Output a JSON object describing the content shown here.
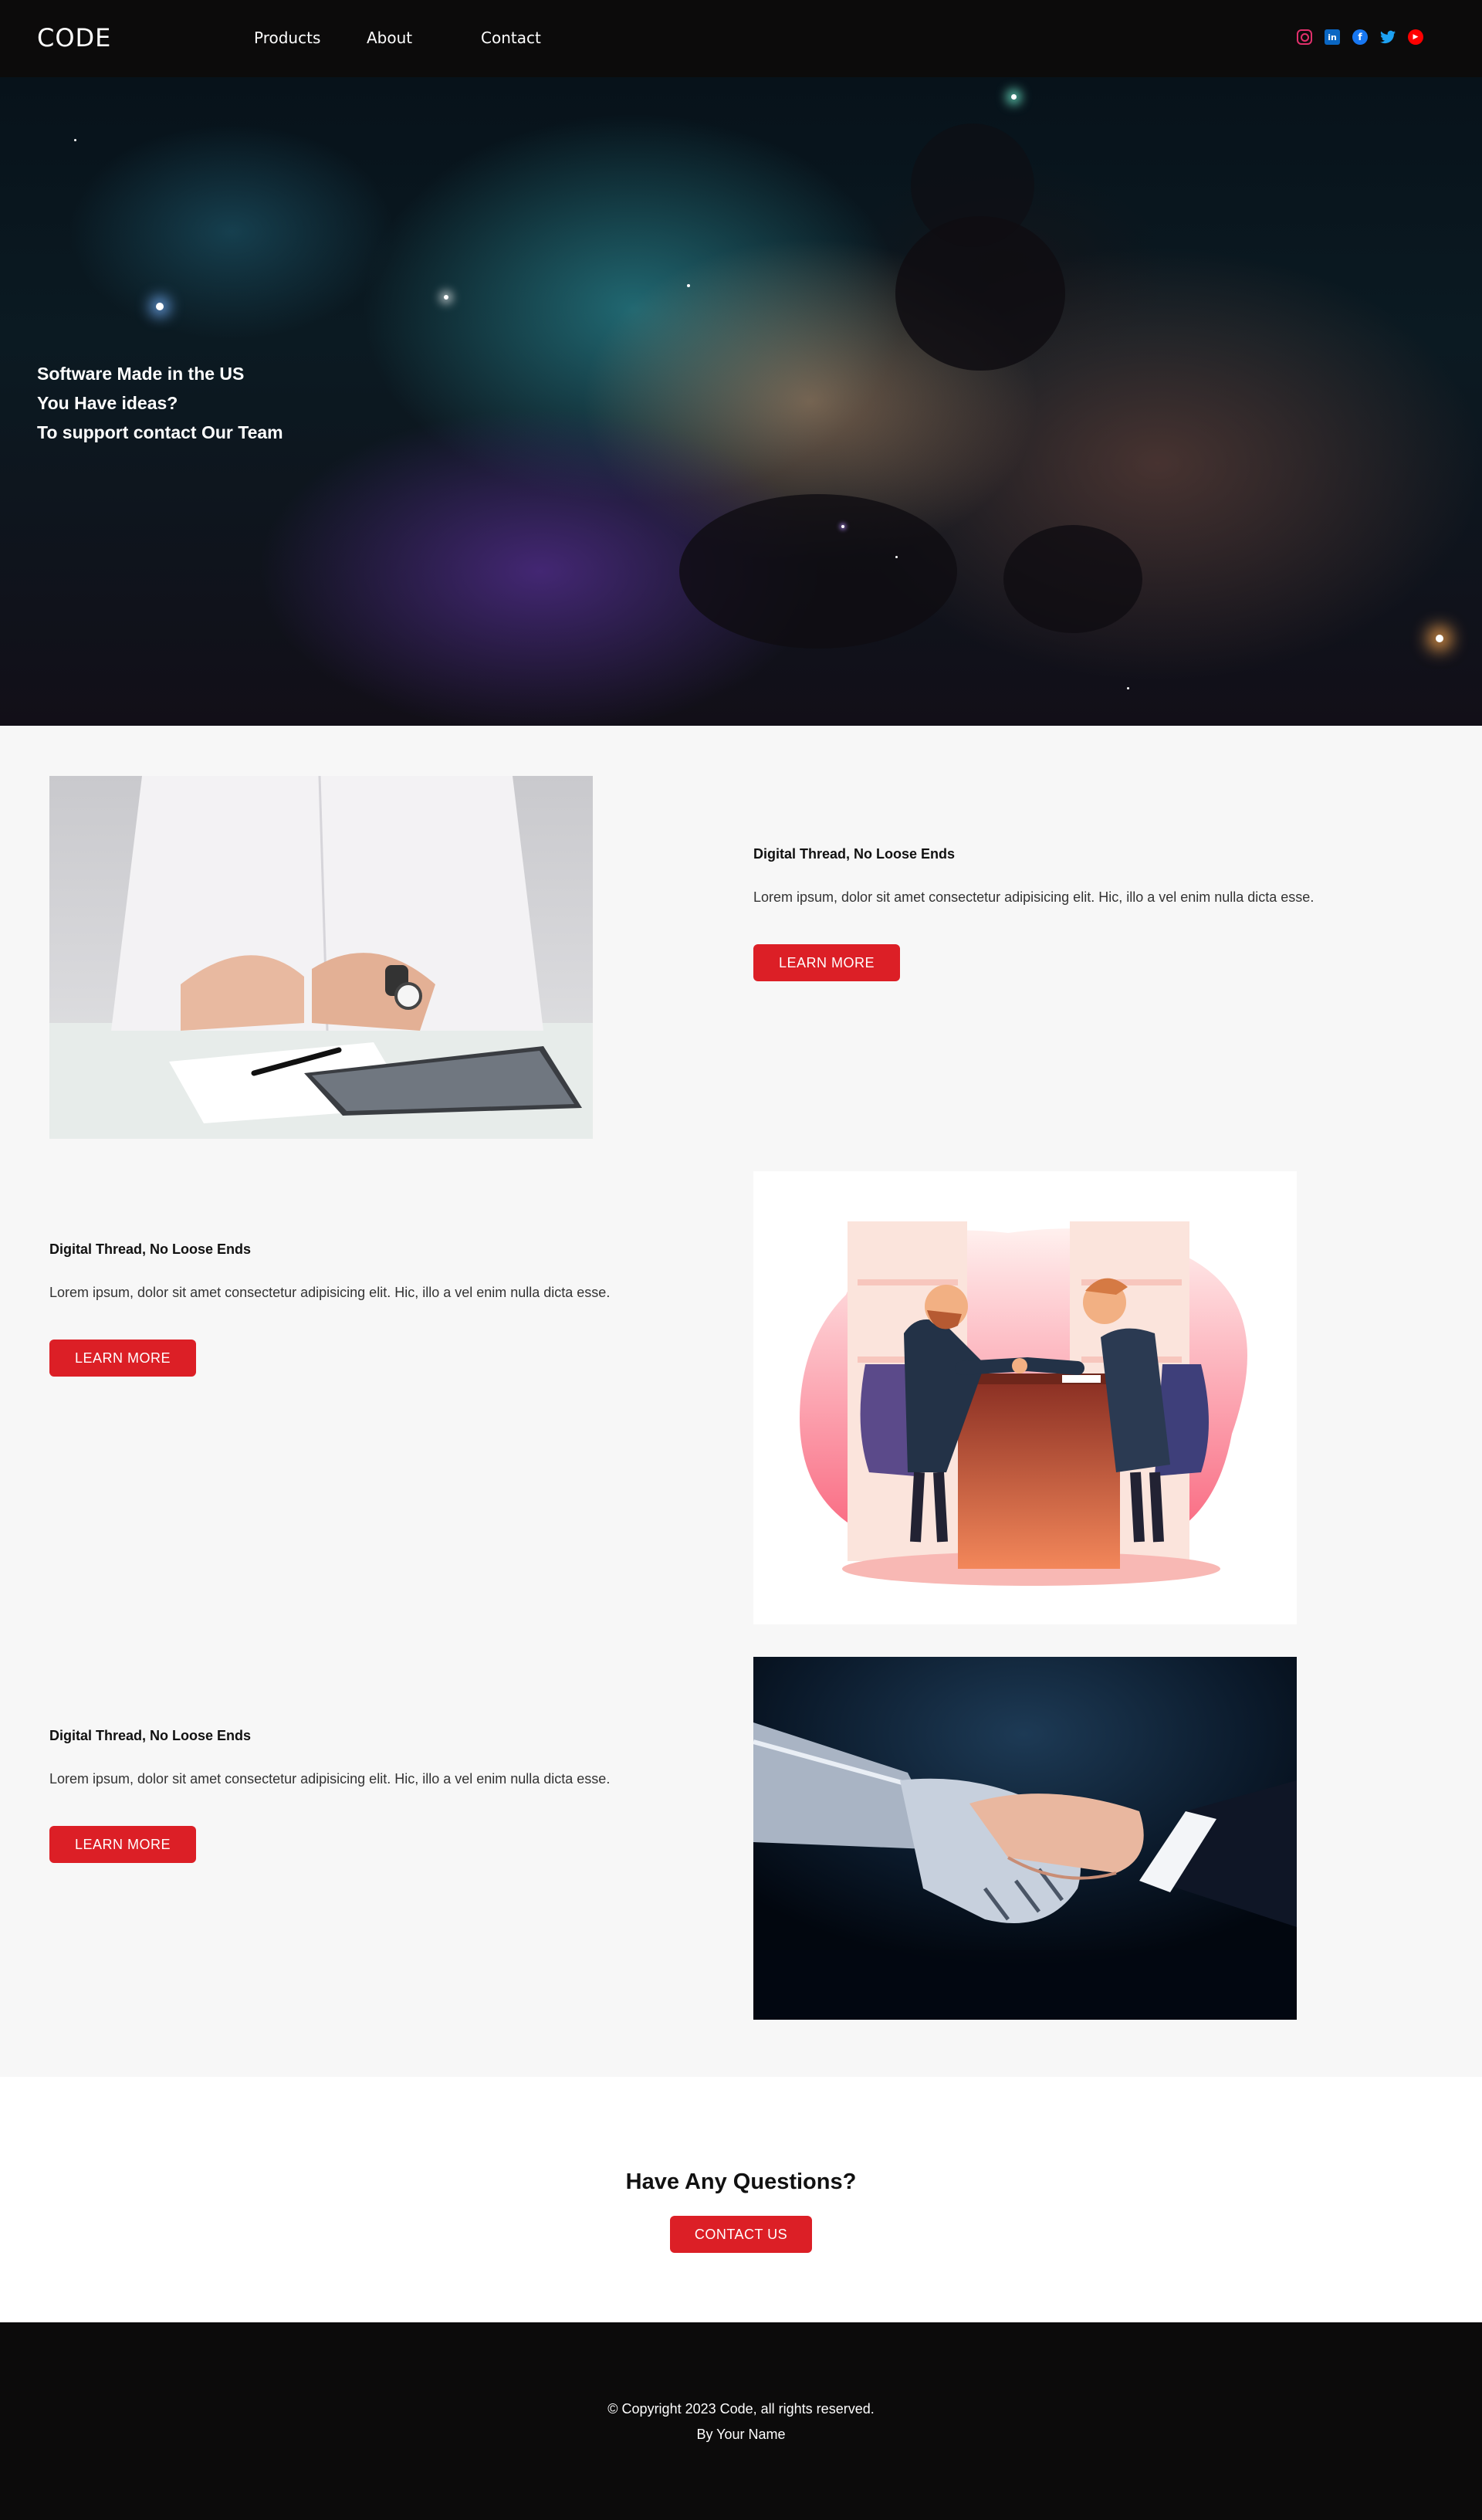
{
  "nav": {
    "logo": "CODE",
    "links": [
      "Products",
      "About",
      "Contact"
    ],
    "socials": [
      "instagram-icon",
      "linkedin-icon",
      "facebook-icon",
      "twitter-icon",
      "youtube-icon"
    ]
  },
  "hero": {
    "lines": [
      "Software Made in the US",
      "You Have ideas?",
      "To support contact Our Team"
    ]
  },
  "features": [
    {
      "title": "Digital Thread, No Loose Ends",
      "text": "Lorem ipsum, dolor sit amet consectetur adipisicing elit. Hic, illo a vel enim nulla dicta esse.",
      "button": "LEARN MORE",
      "image": "businessman-hands-desk-image"
    },
    {
      "title": "Digital Thread, No Loose Ends",
      "text": "Lorem ipsum, dolor sit amet consectetur adipisicing elit. Hic, illo a vel enim nulla dicta esse.",
      "button": "LEARN MORE",
      "image": "handshake-illustration-image"
    },
    {
      "title": "Digital Thread, No Loose Ends",
      "text": "Lorem ipsum, dolor sit amet consectetur adipisicing elit. Hic, illo a vel enim nulla dicta esse.",
      "button": "LEARN MORE",
      "image": "robot-human-handshake-image"
    }
  ],
  "questions": {
    "title": "Have Any Questions?",
    "button": "CONTACT US"
  },
  "footer": {
    "copyright": "© Copyright 2023 Code, all rights reserved.",
    "byline": "By Your Name"
  },
  "colors": {
    "accent": "#dc1f26",
    "nav_bg": "#0c0b0b",
    "section_bg": "#f7f7f7"
  }
}
